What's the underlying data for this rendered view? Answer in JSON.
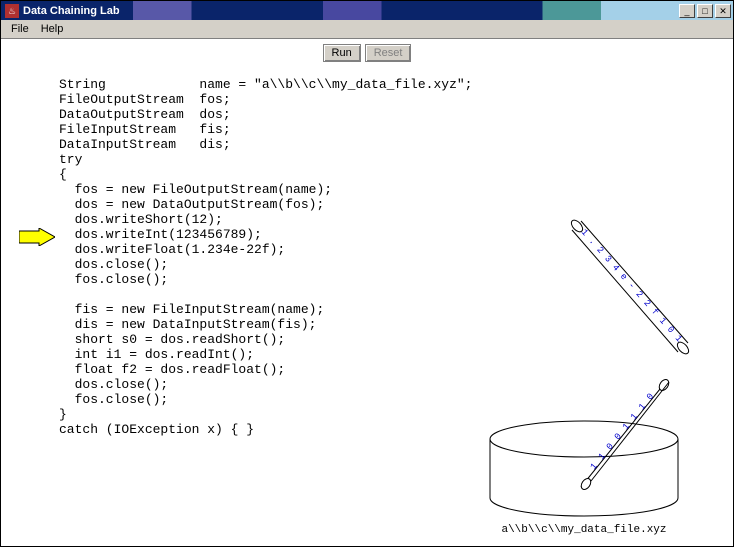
{
  "window": {
    "title": "Data Chaining Lab",
    "icon_glyph": "♨"
  },
  "menu": {
    "file": "File",
    "help": "Help"
  },
  "toolbar": {
    "run": "Run",
    "reset": "Reset"
  },
  "code": "String            name = \"a\\\\b\\\\c\\\\my_data_file.xyz\";\nFileOutputStream  fos;\nDataOutputStream  dos;\nFileInputStream   fis;\nDataInputStream   dis;\ntry\n{\n  fos = new FileOutputStream(name);\n  dos = new DataOutputStream(fos);\n  dos.writeShort(12);\n  dos.writeInt(123456789);\n  dos.writeFloat(1.234e-22f);\n  dos.close();\n  fos.close();\n\n  fis = new FileInputStream(name);\n  dis = new DataInputStream(fis);\n  short s0 = dos.readShort();\n  int i1 = dos.readInt();\n  float f2 = dos.readFloat();\n  dos.close();\n  fos.close();\n}\ncatch (IOException x) { }",
  "execution": {
    "current_line_index": 11
  },
  "graphic": {
    "caption": "a\\\\b\\\\c\\\\my_data_file.xyz",
    "upper_stream_text": "1 . 2 3 4 e - 2 2 f  1 0 1 1 1 0",
    "lower_stream_text": "1 1 0 0 1 1 1 0"
  }
}
